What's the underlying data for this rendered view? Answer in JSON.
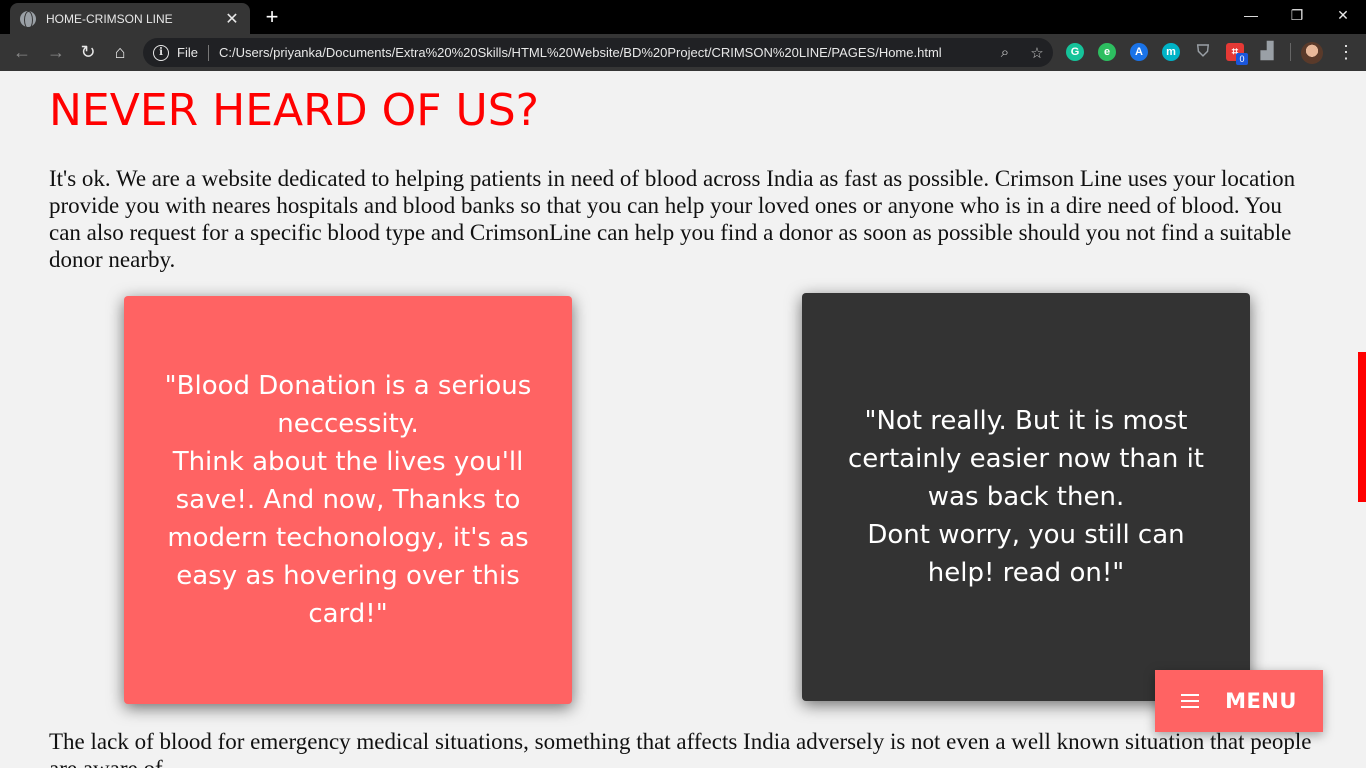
{
  "browser": {
    "tab_title": "HOME-CRIMSON LINE",
    "tab_close": "✕",
    "new_tab": "+",
    "window_controls": {
      "minimize": "—",
      "restore": "❐",
      "close": "✕"
    },
    "nav": {
      "back": "←",
      "forward": "→",
      "reload": "↻",
      "home": "⌂"
    },
    "address": {
      "scheme_label": "File",
      "url": "C:/Users/priyanka/Documents/Extra%20%20Skills/HTML%20Website/BD%20Project/CRIMSON%20LINE/PAGES/Home.html",
      "zoom_icon": "⌕",
      "star_icon": "☆"
    },
    "extensions": [
      {
        "name": "grammarly-icon",
        "glyph": "G",
        "color": "#15c39a"
      },
      {
        "name": "evernote-icon",
        "glyph": "e",
        "color": "#2dbe60"
      },
      {
        "name": "translate-icon",
        "glyph": "A",
        "color": "#1a73e8"
      },
      {
        "name": "m-extension-icon",
        "glyph": "m",
        "color": "#00b3c7"
      },
      {
        "name": "shield-extension-icon",
        "glyph": "⛉",
        "color": "#9aa0a6"
      },
      {
        "name": "grid-extension-icon",
        "glyph": "⌗",
        "color": "#e53935"
      },
      {
        "name": "stats-extension-icon",
        "glyph": "▟",
        "color": "#9aa0a6"
      }
    ],
    "extension_badge": "0",
    "menu_icon": "⋮"
  },
  "content": {
    "heading": "NEVER HEARD OF US?",
    "intro": "It's ok. We are a website dedicated to helping patients in need of blood across India as fast as possible. Crimson Line uses your location provide you with neares hospitals and blood banks so that you can help your loved ones or anyone who is in a dire need of blood. You can also request for a specific blood type and CrimsonLine can help you find a donor as soon as possible should you not find a suitable donor nearby.",
    "card_left": {
      "lines": [
        "\"Blood Donation is a serious neccessity.",
        "Think about the lives you'll save!. And now, Thanks to modern techonology, it's as easy as hovering over this card!\""
      ]
    },
    "card_right": {
      "lines": [
        "\"Not really. But it is most certainly easier now than it was back then.",
        "Dont worry, you still can help! read on!\""
      ]
    },
    "lower_paragraph": "The lack of blood for emergency medical situations, something that affects India adversely is not even a well known situation that people are aware of.",
    "menu_button": "MENU"
  },
  "colors": {
    "heading": "#ff0000",
    "card_left_bg": "#ff6363",
    "card_right_bg": "#333333",
    "menu_bg": "#ff6363",
    "scroll_thumb": "#ff0000"
  }
}
